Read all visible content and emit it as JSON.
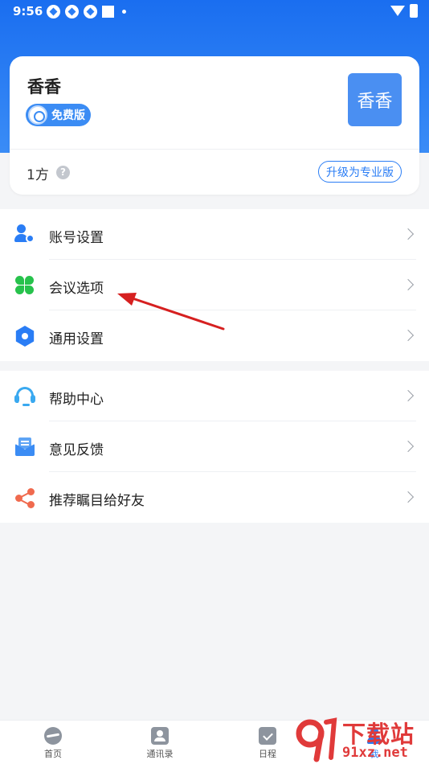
{
  "status_bar": {
    "time": "9:56"
  },
  "profile": {
    "name": "香香",
    "plan_badge": "免费版",
    "avatar_text": "香香",
    "quota": "1方",
    "help_symbol": "?",
    "upgrade_label": "升级为专业版"
  },
  "menu_group_1": [
    {
      "label": "账号设置",
      "icon": "user-settings-icon",
      "color": "#2a7df5"
    },
    {
      "label": "会议选项",
      "icon": "clover-icon",
      "color": "#27c24c"
    },
    {
      "label": "通用设置",
      "icon": "hex-gear-icon",
      "color": "#2a7df5"
    }
  ],
  "menu_group_2": [
    {
      "label": "帮助中心",
      "icon": "headset-icon",
      "color": "#3aa9f0"
    },
    {
      "label": "意见反馈",
      "icon": "feedback-icon",
      "color": "#3b8cf4"
    },
    {
      "label": "推荐瞩目给好友",
      "icon": "share-icon",
      "color": "#f06a4e"
    }
  ],
  "bottom_nav": [
    {
      "label": "首页",
      "icon": "home-icon"
    },
    {
      "label": "通讯录",
      "icon": "contacts-icon"
    },
    {
      "label": "日程",
      "icon": "schedule-icon"
    },
    {
      "label": "我",
      "icon": "me-icon",
      "active": true
    }
  ],
  "watermark": {
    "title": "下载站",
    "url": "91xz.net"
  },
  "colors": {
    "brand_blue": "#2a7df5",
    "header_gradient_top": "#1a6ef0",
    "arrow_red": "#d62020"
  }
}
